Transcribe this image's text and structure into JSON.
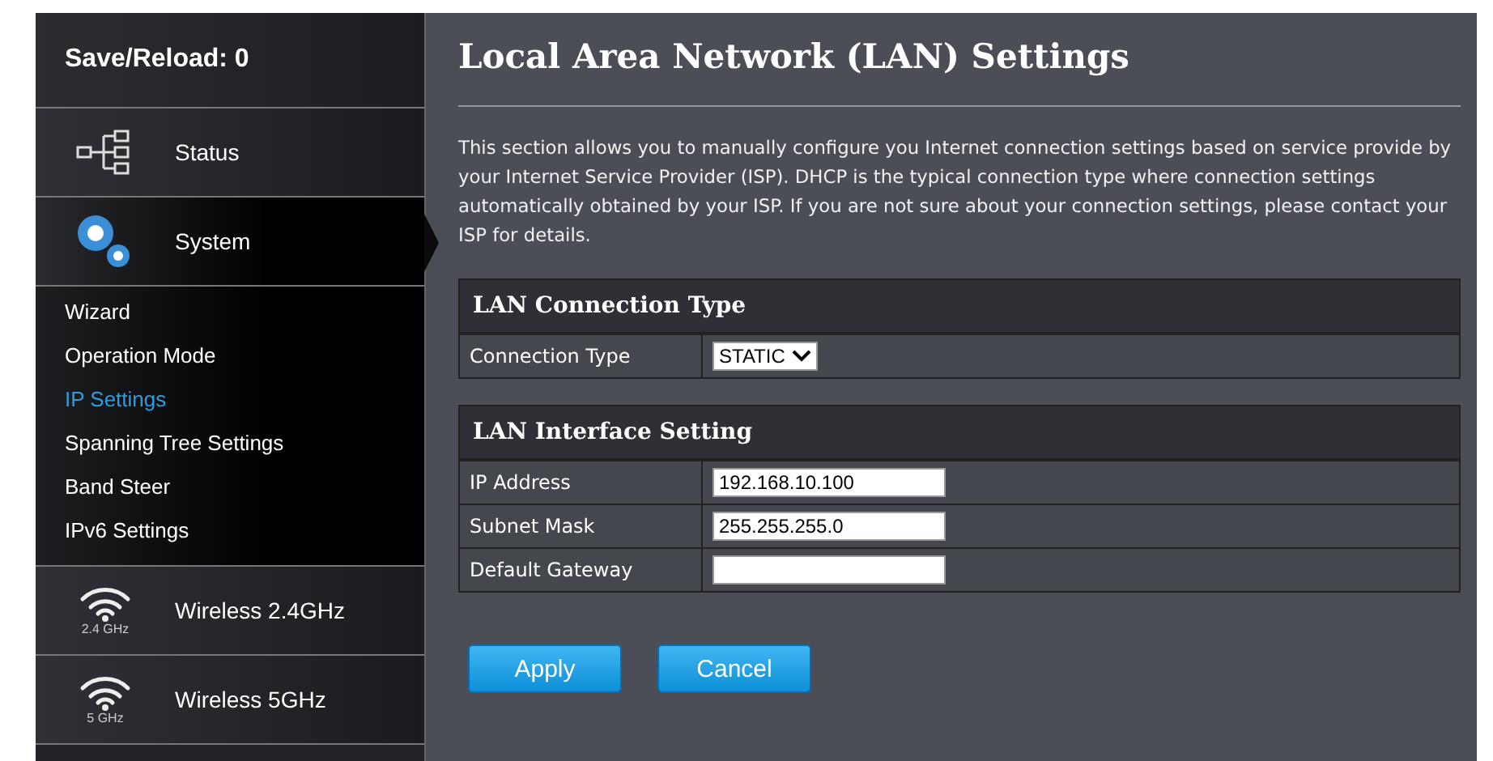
{
  "sidebar": {
    "header": "Save/Reload: 0",
    "sections": [
      {
        "kind": "status",
        "label": "Status",
        "active": false
      },
      {
        "kind": "system",
        "label": "System",
        "active": true,
        "items": [
          {
            "label": "Wizard",
            "selected": false
          },
          {
            "label": "Operation Mode",
            "selected": false
          },
          {
            "label": "IP Settings",
            "selected": true
          },
          {
            "label": "Spanning Tree Settings",
            "selected": false
          },
          {
            "label": "Band Steer",
            "selected": false
          },
          {
            "label": "IPv6 Settings",
            "selected": false
          }
        ]
      },
      {
        "kind": "wifi",
        "label": "Wireless 2.4GHz",
        "icon_caption": "2.4 GHz",
        "active": false
      },
      {
        "kind": "wifi",
        "label": "Wireless 5GHz",
        "icon_caption": "5 GHz",
        "active": false
      }
    ]
  },
  "main": {
    "title": "Local Area Network (LAN) Settings",
    "description": "This section allows you to manually configure you Internet connection settings based on service provide by your Internet Service Provider (ISP). DHCP is the typical connection type where connection settings automatically obtained by your ISP. If you are not sure about your connection settings, please contact your ISP for details.",
    "groups": [
      {
        "title": "LAN Connection Type",
        "rows": [
          {
            "kind": "select",
            "label": "Connection Type",
            "value": "STATIC"
          }
        ]
      },
      {
        "title": "LAN Interface Setting",
        "rows": [
          {
            "kind": "text",
            "label": "IP Address",
            "value": "192.168.10.100"
          },
          {
            "kind": "text",
            "label": "Subnet Mask",
            "value": "255.255.255.0"
          },
          {
            "kind": "text",
            "label": "Default Gateway",
            "value": ""
          }
        ]
      }
    ],
    "buttons": [
      "Apply",
      "Cancel"
    ]
  }
}
